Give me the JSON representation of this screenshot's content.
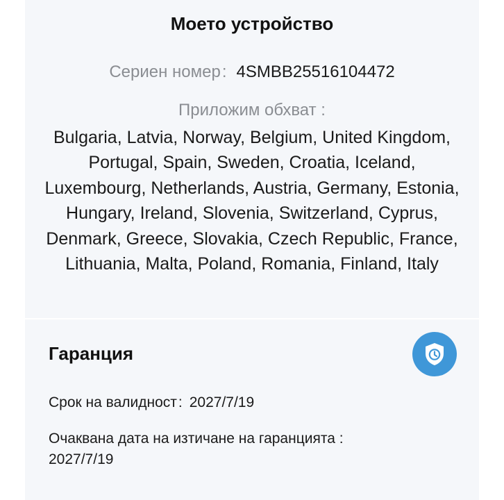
{
  "device": {
    "title": "Моето устройство",
    "serial_label": "Сериен номер",
    "serial_separator": ":",
    "serial_value": "4SMBB25516104472",
    "scope_label": "Приложим обхват :",
    "scope_countries": "Bulgaria, Latvia, Norway, Belgium, United Kingdom, Portugal, Spain, Sweden, Croatia, Iceland, Luxembourg, Netherlands, Austria, Germany, Estonia, Hungary, Ireland, Slovenia, Switzerland, Cyprus, Denmark, Greece, Slovakia, Czech Republic, France, Lithuania, Malta, Poland, Romania, Finland, Italy"
  },
  "warranty": {
    "title": "Гаранция",
    "icon": "shield-clock-icon",
    "accent_color": "#3f97d8",
    "validity_label": "Срок на валидност",
    "validity_separator": ":",
    "validity_value": "2027/7/19",
    "expiry_label": "Очаквана дата на изтичане на гаранцията :",
    "expiry_value": "2027/7/19"
  }
}
